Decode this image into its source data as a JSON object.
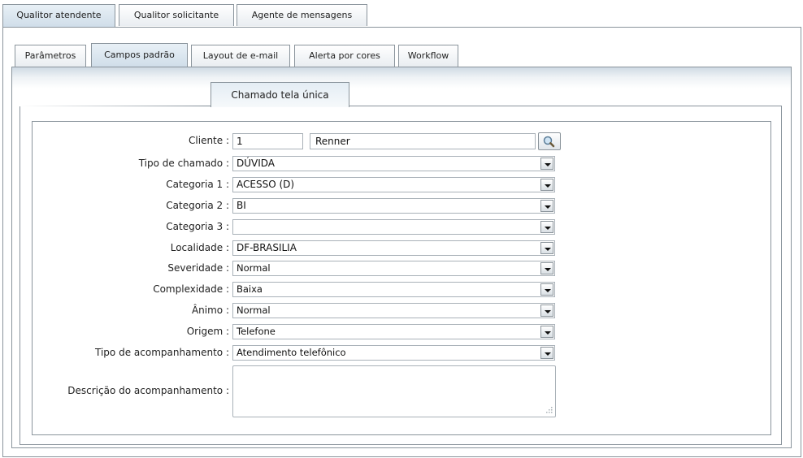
{
  "top_tabs": [
    "Qualitor atendente",
    "Qualitor solicitante",
    "Agente de mensagens"
  ],
  "sub_tabs": [
    "Parâmetros",
    "Campos padrão",
    "Layout de e-mail",
    "Alerta por cores",
    "Workflow"
  ],
  "inner_tab": "Chamado tela única",
  "form": {
    "cliente": {
      "label": "Cliente :",
      "code": "1",
      "name": "Renner"
    },
    "selects": [
      {
        "label": "Tipo de chamado :",
        "value": "DÚVIDA"
      },
      {
        "label": "Categoria 1 :",
        "value": "ACESSO (D)"
      },
      {
        "label": "Categoria 2 :",
        "value": "BI"
      },
      {
        "label": "Categoria 3 :",
        "value": ""
      },
      {
        "label": "Localidade :",
        "value": "DF-BRASILIA"
      },
      {
        "label": "Severidade :",
        "value": "Normal"
      },
      {
        "label": "Complexidade :",
        "value": "Baixa"
      },
      {
        "label": "Ânimo :",
        "value": "Normal"
      },
      {
        "label": "Origem :",
        "value": "Telefone"
      },
      {
        "label": "Tipo de acompanhamento :",
        "value": "Atendimento telefônico"
      }
    ],
    "descricao": {
      "label": "Descrição do acompanhamento :",
      "value": ""
    }
  }
}
